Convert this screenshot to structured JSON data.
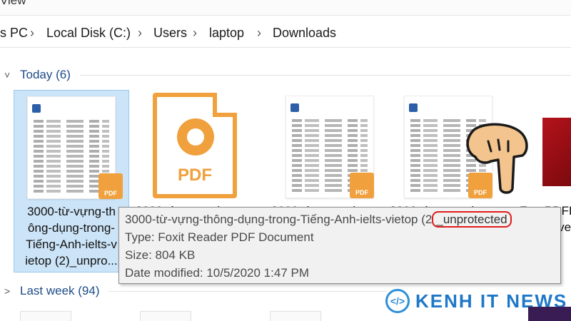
{
  "ribbon": {
    "view_label": "View"
  },
  "breadcrumb": {
    "items": [
      "s PC",
      "Local Disk (C:)",
      "Users",
      "laptop",
      "Downloads"
    ],
    "separator": "›"
  },
  "groups": {
    "today": {
      "label": "Today (6)",
      "chevron": "˅"
    },
    "last_week": {
      "label": "Last week (94)",
      "chevron": "˃"
    }
  },
  "files": [
    {
      "name_lines": [
        "3000-từ-vựng-th",
        "ông-dụng-trong-",
        "Tiếng-Anh-ielts-v",
        "ietop (2)_unpro..."
      ],
      "selected": true,
      "icon": "pdf-thumbnail"
    },
    {
      "name_lines": [
        "3000-từ-vựng-th"
      ],
      "selected": false,
      "icon": "foxit-pdf-icon"
    },
    {
      "name_lines": [
        "3000-từ-vựng-th"
      ],
      "selected": false,
      "icon": "pdf-thumbnail"
    },
    {
      "name_lines": [
        "3000-từ-vựng-th"
      ],
      "selected": false,
      "icon": "pdf-thumbnail"
    },
    {
      "name_lines": [
        "FreePDFF",
        "...ve"
      ],
      "selected": false,
      "icon": "pdf-red-icon"
    }
  ],
  "foxit_icon": {
    "text": "PDF"
  },
  "tooltip": {
    "name_prefix": "3000-từ-vựng-thông-dụng-trong-Tiếng-Anh-ielts-vietop (2",
    "name_highlight": "_unprotected",
    "type": "Type: Foxit Reader PDF Document",
    "size": "Size: 804 KB",
    "date": "Date modified: 10/5/2020 1:47 PM"
  },
  "watermark": {
    "icon_text": "</>",
    "text": "KENH IT NEWS"
  },
  "colors": {
    "foxit_orange": "#f0a03c",
    "selection": "#cce4f7",
    "group_label": "#1e4b87",
    "highlight_ring": "#e01b1b",
    "watermark_blue": "#1e78c8"
  }
}
